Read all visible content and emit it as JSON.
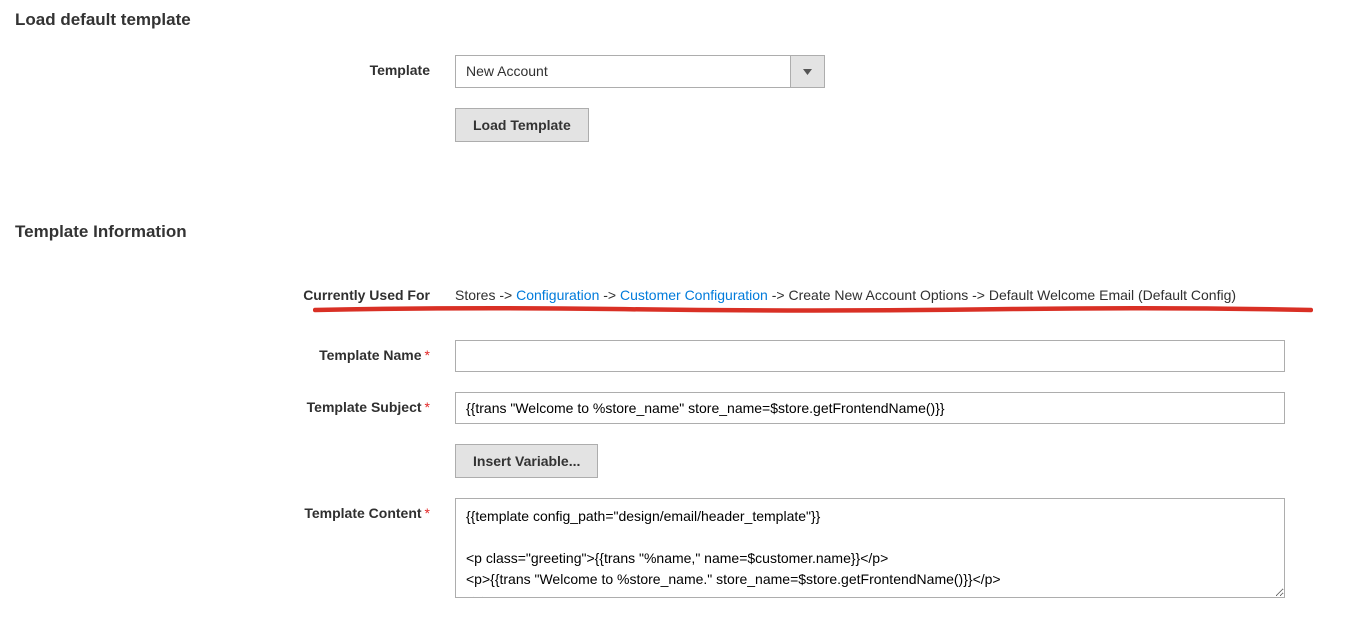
{
  "loadSection": {
    "title": "Load default template",
    "templateLabel": "Template",
    "templateValue": "New Account",
    "loadButton": "Load Template"
  },
  "infoSection": {
    "title": "Template Information",
    "usedForLabel": "Currently Used For",
    "path": {
      "p1": "Stores",
      "sep": " -> ",
      "p2": "Configuration",
      "p3": "Customer Configuration",
      "p4": "Create New Account Options",
      "p5": "Default Welcome Email  (Default Config)"
    },
    "nameLabel": "Template Name",
    "nameValue": "",
    "subjectLabel": "Template Subject",
    "subjectValue": "{{trans \"Welcome to %store_name\" store_name=$store.getFrontendName()}}",
    "insertVarButton": "Insert Variable...",
    "contentLabel": "Template Content",
    "contentValue": "{{template config_path=\"design/email/header_template\"}}\n\n<p class=\"greeting\">{{trans \"%name,\" name=$customer.name}}</p>\n<p>{{trans \"Welcome to %store_name.\" store_name=$store.getFrontendName()}}</p>\n<p>\n    {{trans"
  }
}
